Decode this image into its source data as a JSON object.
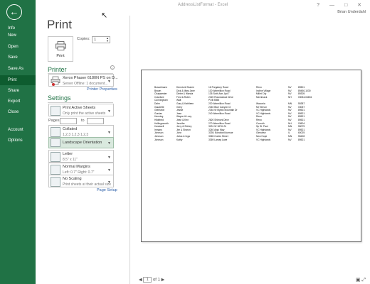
{
  "window": {
    "title": "AddressListFormat - Excel",
    "user": "Brian Underdahl",
    "controls": "?  —  □  ✕"
  },
  "nav": {
    "back_glyph": "←",
    "items": [
      "Info",
      "New",
      "Open",
      "Save",
      "Save As",
      "Print",
      "Share",
      "Export",
      "Close",
      "Account",
      "Options"
    ]
  },
  "print": {
    "heading": "Print",
    "print_button": "Print",
    "copies_label": "Copies:",
    "copies_value": "1"
  },
  "printer": {
    "section": "Printer",
    "name": "Xerox Phaser 6180N PS on D...",
    "status": "Server Offline: 1 document...",
    "properties_link": "Printer Properties",
    "info_glyph": "i"
  },
  "settings": {
    "section": "Settings",
    "what": {
      "title": "Print Active Sheets",
      "sub": "Only print the active sheets"
    },
    "pages_label": "Pages:",
    "to_label": "to",
    "collate": {
      "title": "Collated",
      "sub": "1,2,3    1,2,3    1,2,3"
    },
    "orientation": {
      "title": "Landscape Orientation"
    },
    "paper": {
      "title": "Letter",
      "sub": "8.5\" x 11\""
    },
    "margins": {
      "title": "Normal Margins",
      "sub": "Left: 0.7\"   Right: 0.7\""
    },
    "scaling": {
      "title": "No Scaling",
      "sub": "Print sheets at their actual size"
    },
    "page_setup_link": "Page Setup"
  },
  "sheet_rows": [
    [
      "Bosselmann",
      "Dennis & Sharee",
      "16 Purgatory Road",
      "Reno",
      "NV",
      "89501"
    ],
    [
      "Brown",
      "Dick & Mary Jane",
      "130 Warmillion Road",
      "Incline Village",
      "NV",
      "89450-1030"
    ],
    [
      "Chapwester",
      "Dieter & Wanda",
      "135 Sixth Ave, Apt 7",
      "Millet City",
      "NV",
      "89305"
    ],
    [
      "Crawford",
      "Fred & Robin",
      "2320 Roundabout Drive",
      "Merrimack",
      "NH",
      "03054-04831"
    ],
    [
      "Cunningham",
      "Walt",
      "POB 5555",
      "",
      "",
      ""
    ],
    [
      "Dahn",
      "Gary & Kathleen",
      "230 Warmillion Road",
      "Waconia",
      "MN",
      "55387"
    ],
    [
      "Gaudette",
      "Gerry",
      "2340 Blue Canyon Ct",
      "Mt Vernon",
      "NV",
      "03057"
    ],
    [
      "Gebhardt",
      "Jessie",
      "2354 W Mystic Mountain Dr",
      "VC Highlands",
      "NV",
      "89521"
    ],
    [
      "Gordas",
      "Jean",
      "240 Warmillion Road",
      "VC Highlands",
      "NV",
      "89521"
    ],
    [
      "Henning",
      "Wayne & Lucy",
      "",
      "Reno",
      "NV",
      "89521"
    ],
    [
      "Hildebrid",
      "Jean & Ken",
      "2620 Shimoni Drive",
      "Reno",
      "NV",
      "89521"
    ],
    [
      "Hollingsworth",
      "Jennifer",
      "270 Warmillion Road",
      "Conroth",
      "NH",
      "03604"
    ],
    [
      "Hoskwell",
      "Jerry & Shirley",
      "3231 W 187th St",
      "Sp St. Paul",
      "MN",
      "55075"
    ],
    [
      "Inmans",
      "Jim & Sharon",
      "3240 Argo Way",
      "VC Highlands",
      "NV",
      "89521"
    ],
    [
      "Johnson",
      "John",
      "3339, Bonaford Avenue",
      "Glenview",
      "IL",
      "60025"
    ],
    [
      "Johnson",
      "Julius & Inga",
      "3365 Cortes Street",
      "New Hope",
      "MN",
      "55428"
    ],
    [
      "Johnson",
      "Kathy",
      "3369 Lamay Lane",
      "VC Highlands",
      "NV",
      "89521"
    ]
  ],
  "preview": {
    "prev_glyph": "◀",
    "next_glyph": "▶",
    "page_current": "1",
    "page_of": "of 1",
    "zoom_glyphs": "▣ ⤢"
  },
  "colors": {
    "nav_green": "#207245",
    "nav_active": "#0e5c2f",
    "accent_green": "#207245"
  },
  "icons": [
    "back-arrow-icon",
    "printer-icon",
    "info-icon",
    "sheets-icon",
    "collate-icon",
    "orientation-icon",
    "paper-icon",
    "margins-icon",
    "scaling-icon",
    "show-margins-icon",
    "zoom-to-page-icon"
  ]
}
